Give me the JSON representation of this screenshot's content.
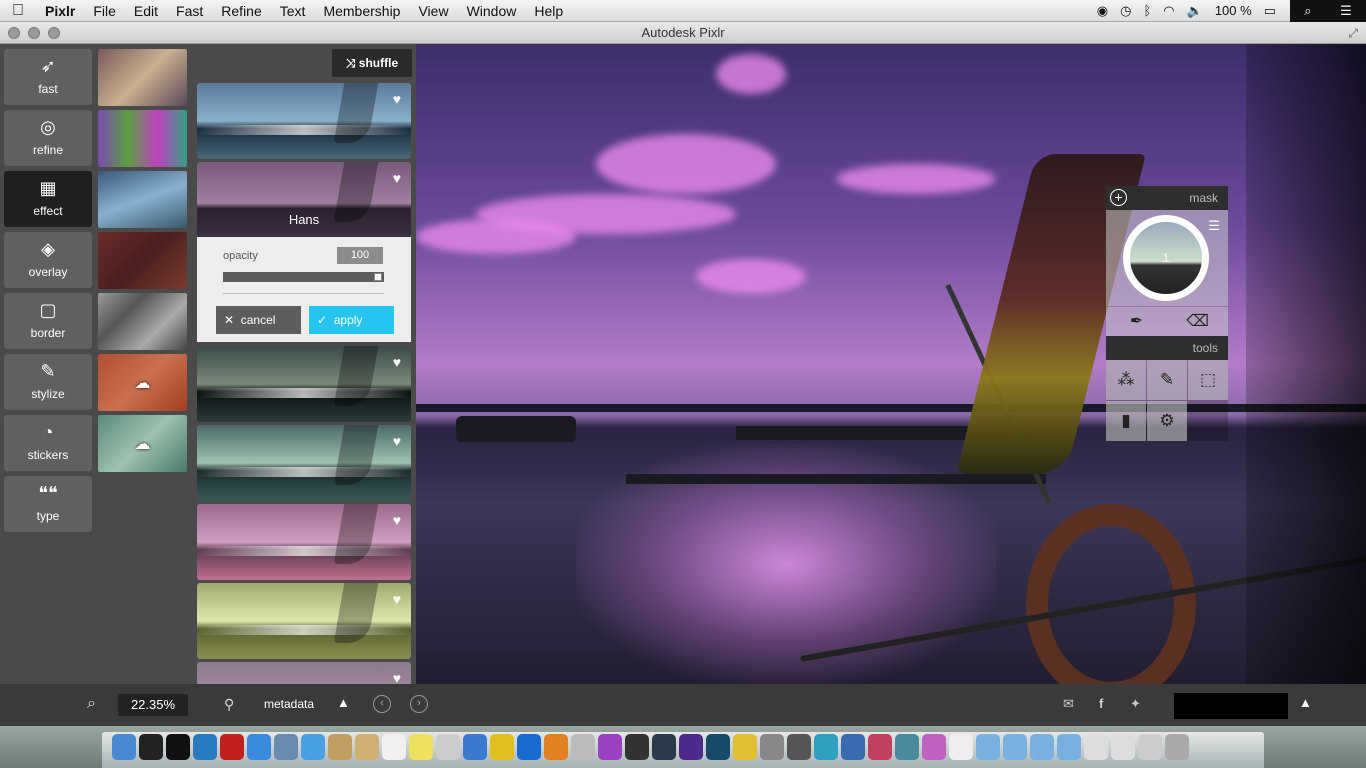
{
  "menubar": {
    "apple": "",
    "items": [
      "Pixlr",
      "File",
      "Edit",
      "Fast",
      "Refine",
      "Text",
      "Membership",
      "View",
      "Window",
      "Help"
    ],
    "battery": "100 %"
  },
  "window": {
    "title": "Autodesk Pixlr"
  },
  "toolnav": [
    {
      "icon": "rocket-icon",
      "label": "fast"
    },
    {
      "icon": "refine-icon",
      "label": "refine"
    },
    {
      "icon": "film-icon",
      "label": "effect"
    },
    {
      "icon": "layers-icon",
      "label": "overlay"
    },
    {
      "icon": "border-icon",
      "label": "border"
    },
    {
      "icon": "brush-icon",
      "label": "stylize"
    },
    {
      "icon": "sticker-icon",
      "label": "stickers"
    },
    {
      "icon": "quote-icon",
      "label": "type"
    }
  ],
  "effects": {
    "shuffle_label": "shuffle",
    "selected_name": "Hans",
    "opacity_label": "opacity",
    "opacity_value": "100",
    "opacity": 1.0,
    "cancel_label": "cancel",
    "apply_label": "apply"
  },
  "mask_panel": {
    "mask_label": "mask",
    "layer_number": "1",
    "tools_label": "tools"
  },
  "bottombar": {
    "zoom": "22.35%",
    "metadata_label": "metadata"
  },
  "colors": {
    "accent": "#25c5f0",
    "panel_bg": "#4a4a4a",
    "active_tool": "#1f1f1f"
  }
}
